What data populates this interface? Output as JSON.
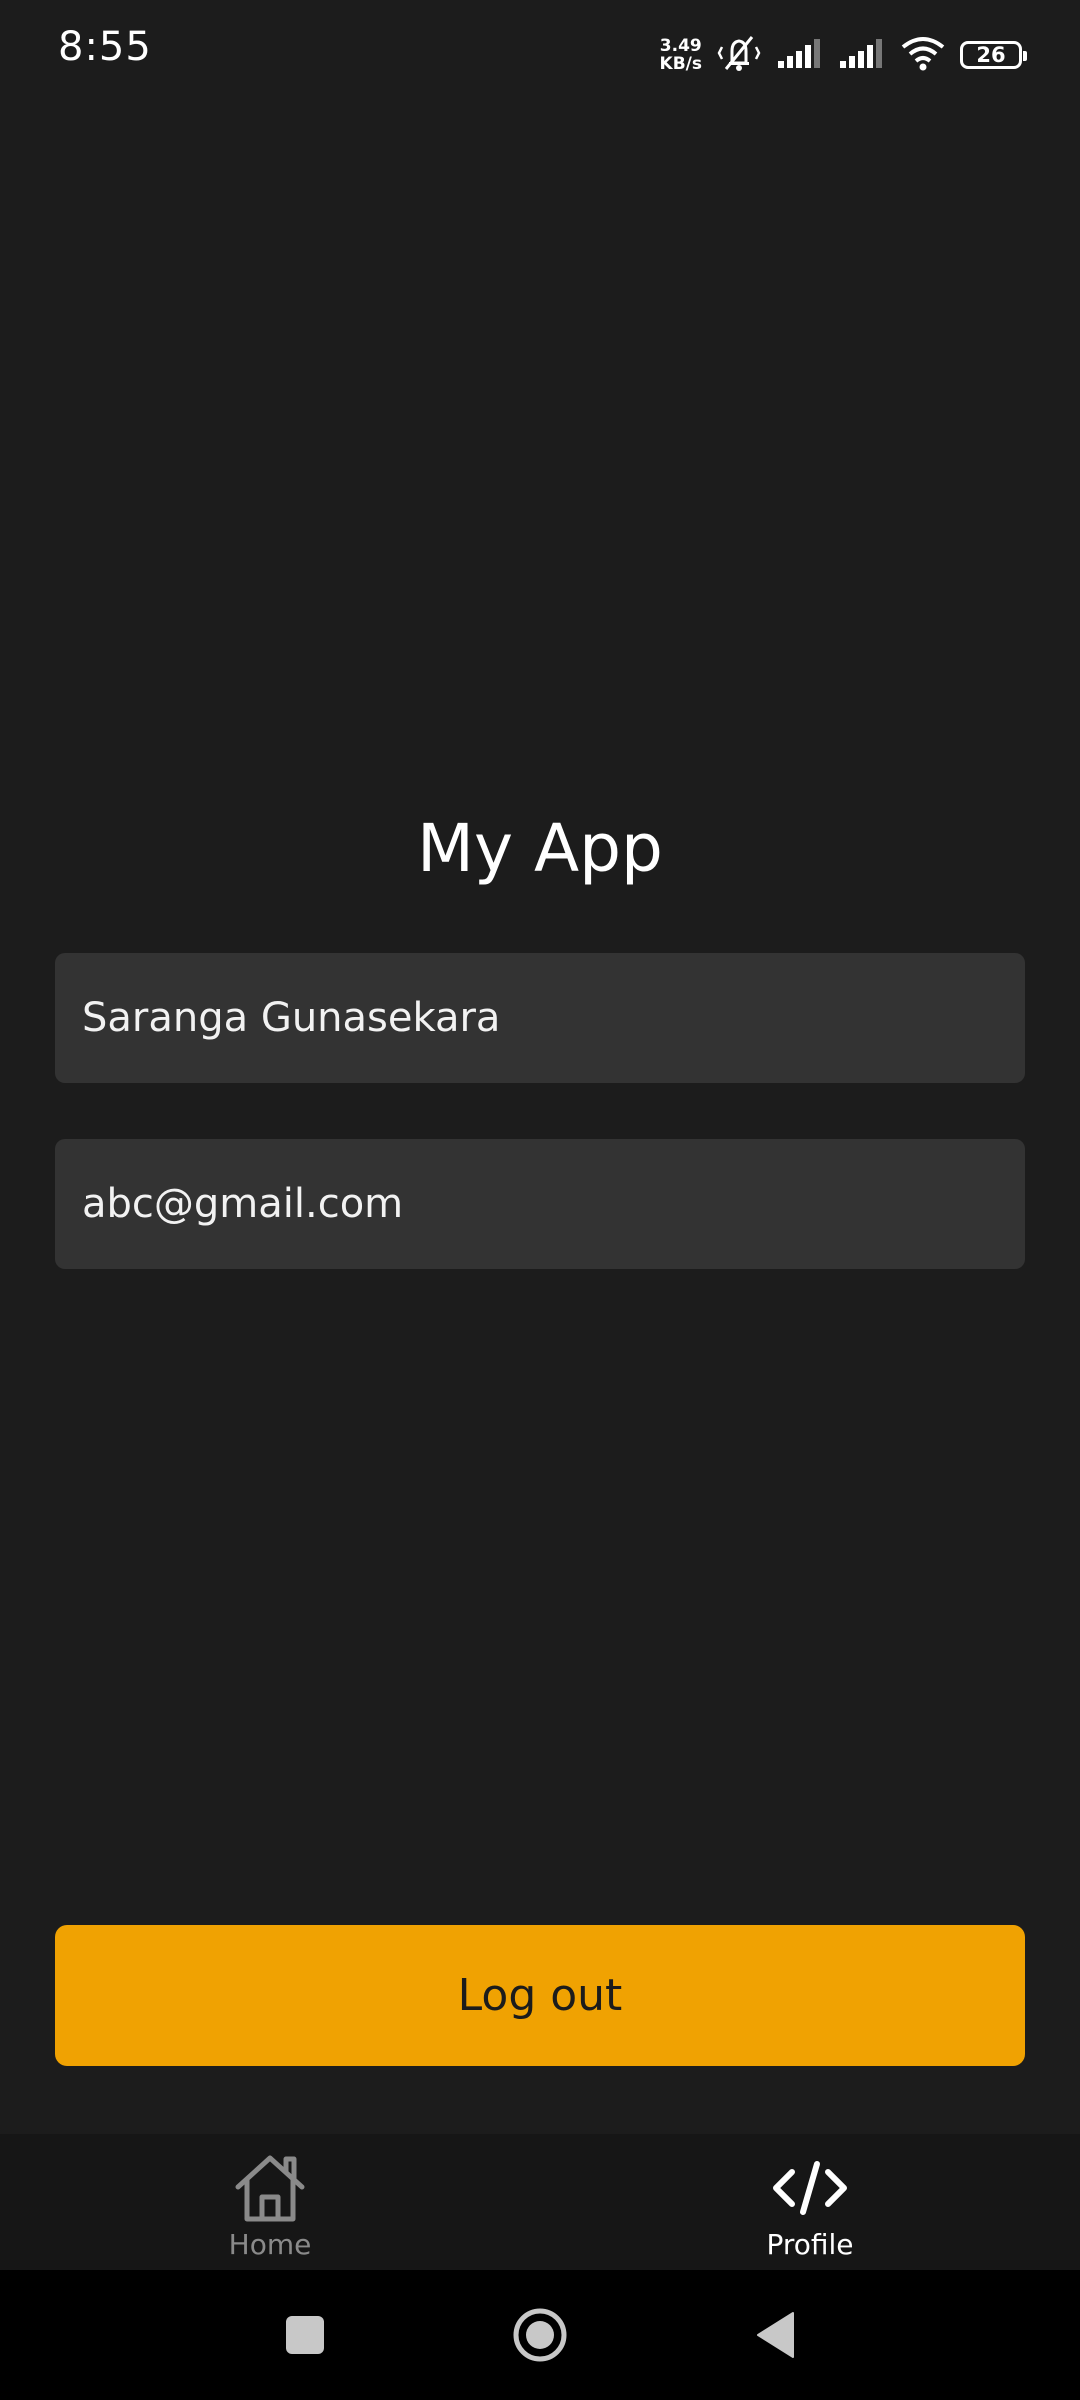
{
  "status_bar": {
    "time": "8:55",
    "net_speed_value": "3.49",
    "net_speed_unit": "KB/s",
    "battery_level": "26",
    "icons": [
      "mute-vibrate-icon",
      "signal-icon",
      "signal-icon",
      "wifi-icon",
      "battery-icon"
    ]
  },
  "main": {
    "title": "My App",
    "name_field_value": "Saranga Gunasekara",
    "email_field_value": "abc@gmail.com",
    "logout_label": "Log out"
  },
  "bottom_nav": {
    "items": [
      {
        "label": "Home",
        "icon": "home-icon",
        "selected": false
      },
      {
        "label": "Profile",
        "icon": "code-icon",
        "selected": true
      }
    ]
  },
  "system_nav": {
    "icons": [
      "recents-icon",
      "home-circle-icon",
      "back-triangle-icon"
    ]
  },
  "colors": {
    "background": "#1c1c1c",
    "field_background": "#333333",
    "accent": "#f0a202",
    "nav_background": "#161616",
    "inactive": "#8a8a8a"
  }
}
